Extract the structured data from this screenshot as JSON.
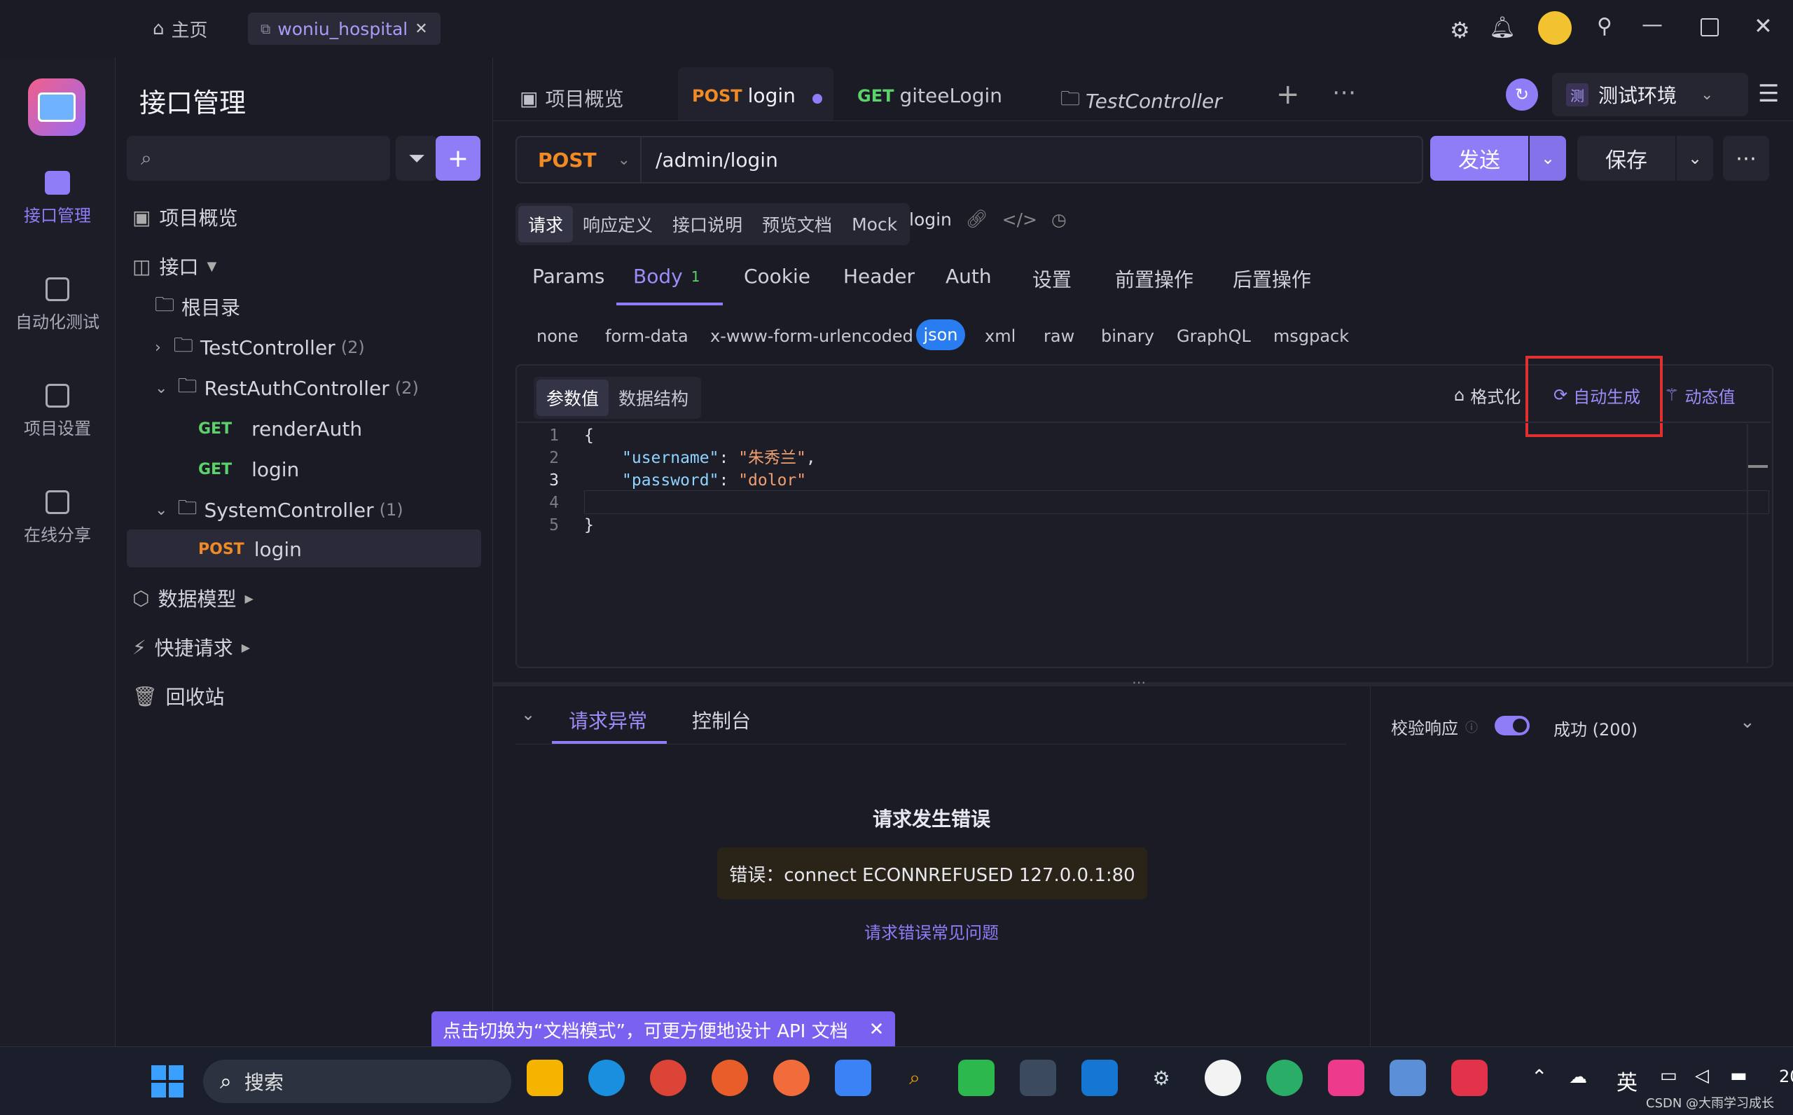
{
  "titlebar": {
    "home_label": "主页",
    "project_tab": "woniu_hospital"
  },
  "rail": {
    "items": [
      {
        "label": "接口管理"
      },
      {
        "label": "自动化测试"
      },
      {
        "label": "项目设置"
      },
      {
        "label": "在线分享"
      }
    ]
  },
  "tree": {
    "title": "接口管理",
    "overview": "项目概览",
    "interfaces": "接口",
    "root": "根目录",
    "folders": [
      {
        "name": "TestController",
        "count": "(2)"
      },
      {
        "name": "RestAuthController",
        "count": "(2)"
      },
      {
        "name": "SystemController",
        "count": "(1)"
      }
    ],
    "endpoints": [
      {
        "method": "GET",
        "name": "renderAuth"
      },
      {
        "method": "GET",
        "name": "login"
      },
      {
        "method": "POST",
        "name": "login"
      }
    ],
    "data_models": "数据模型",
    "quick_requests": "快捷请求",
    "recycle_bin": "回收站"
  },
  "tabs": {
    "overview": "项目概览",
    "tab1_method": "POST",
    "tab1_name": "login",
    "tab2_method": "GET",
    "tab2_name": "giteeLogin",
    "tab3_name": "TestController"
  },
  "env": {
    "badge": "测",
    "name": "测试环境"
  },
  "request": {
    "method": "POST",
    "url": "/admin/login",
    "send": "发送",
    "save": "保存"
  },
  "segments": [
    "请求",
    "响应定义",
    "接口说明",
    "预览文档",
    "Mock"
  ],
  "endpoint_name": "login",
  "subtabs": [
    "Params",
    "Body",
    "Cookie",
    "Header",
    "Auth",
    "设置",
    "前置操作",
    "后置操作"
  ],
  "body_count": "1",
  "body_types": [
    "none",
    "form-data",
    "x-www-form-urlencoded",
    "json",
    "xml",
    "raw",
    "binary",
    "GraphQL",
    "msgpack"
  ],
  "editor": {
    "mode_values": "参数值",
    "mode_schema": "数据结构",
    "format": "格式化",
    "auto_generate": "自动生成",
    "dynamic_value": "动态值",
    "line_numbers": [
      "1",
      "2",
      "3",
      "4",
      "5"
    ],
    "open_brace": "{",
    "close_brace": "}",
    "key1": "\"username\"",
    "val1": "\"朱秀兰\"",
    "key2": "\"password\"",
    "val2": "\"dolor\""
  },
  "bottom": {
    "tab_error": "请求异常",
    "tab_console": "控制台",
    "validate": "校验响应",
    "status": "成功 (200)",
    "error_title": "请求发生错误",
    "error_msg": "错误：connect ECONNREFUSED 127.0.0.1:80",
    "faq": "请求错误常见问题",
    "tooltip": "点击切换为“文档模式”，可更方便地设计 API 文档"
  },
  "taskbar": {
    "search": "搜索",
    "ime": "英",
    "watermark": "CSDN @大雨学习成长",
    "time": "20"
  },
  "colors": {
    "accent": "#8f7cf7",
    "post": "#f08a24",
    "get": "#5bd36a",
    "highlight": "#e03030"
  }
}
